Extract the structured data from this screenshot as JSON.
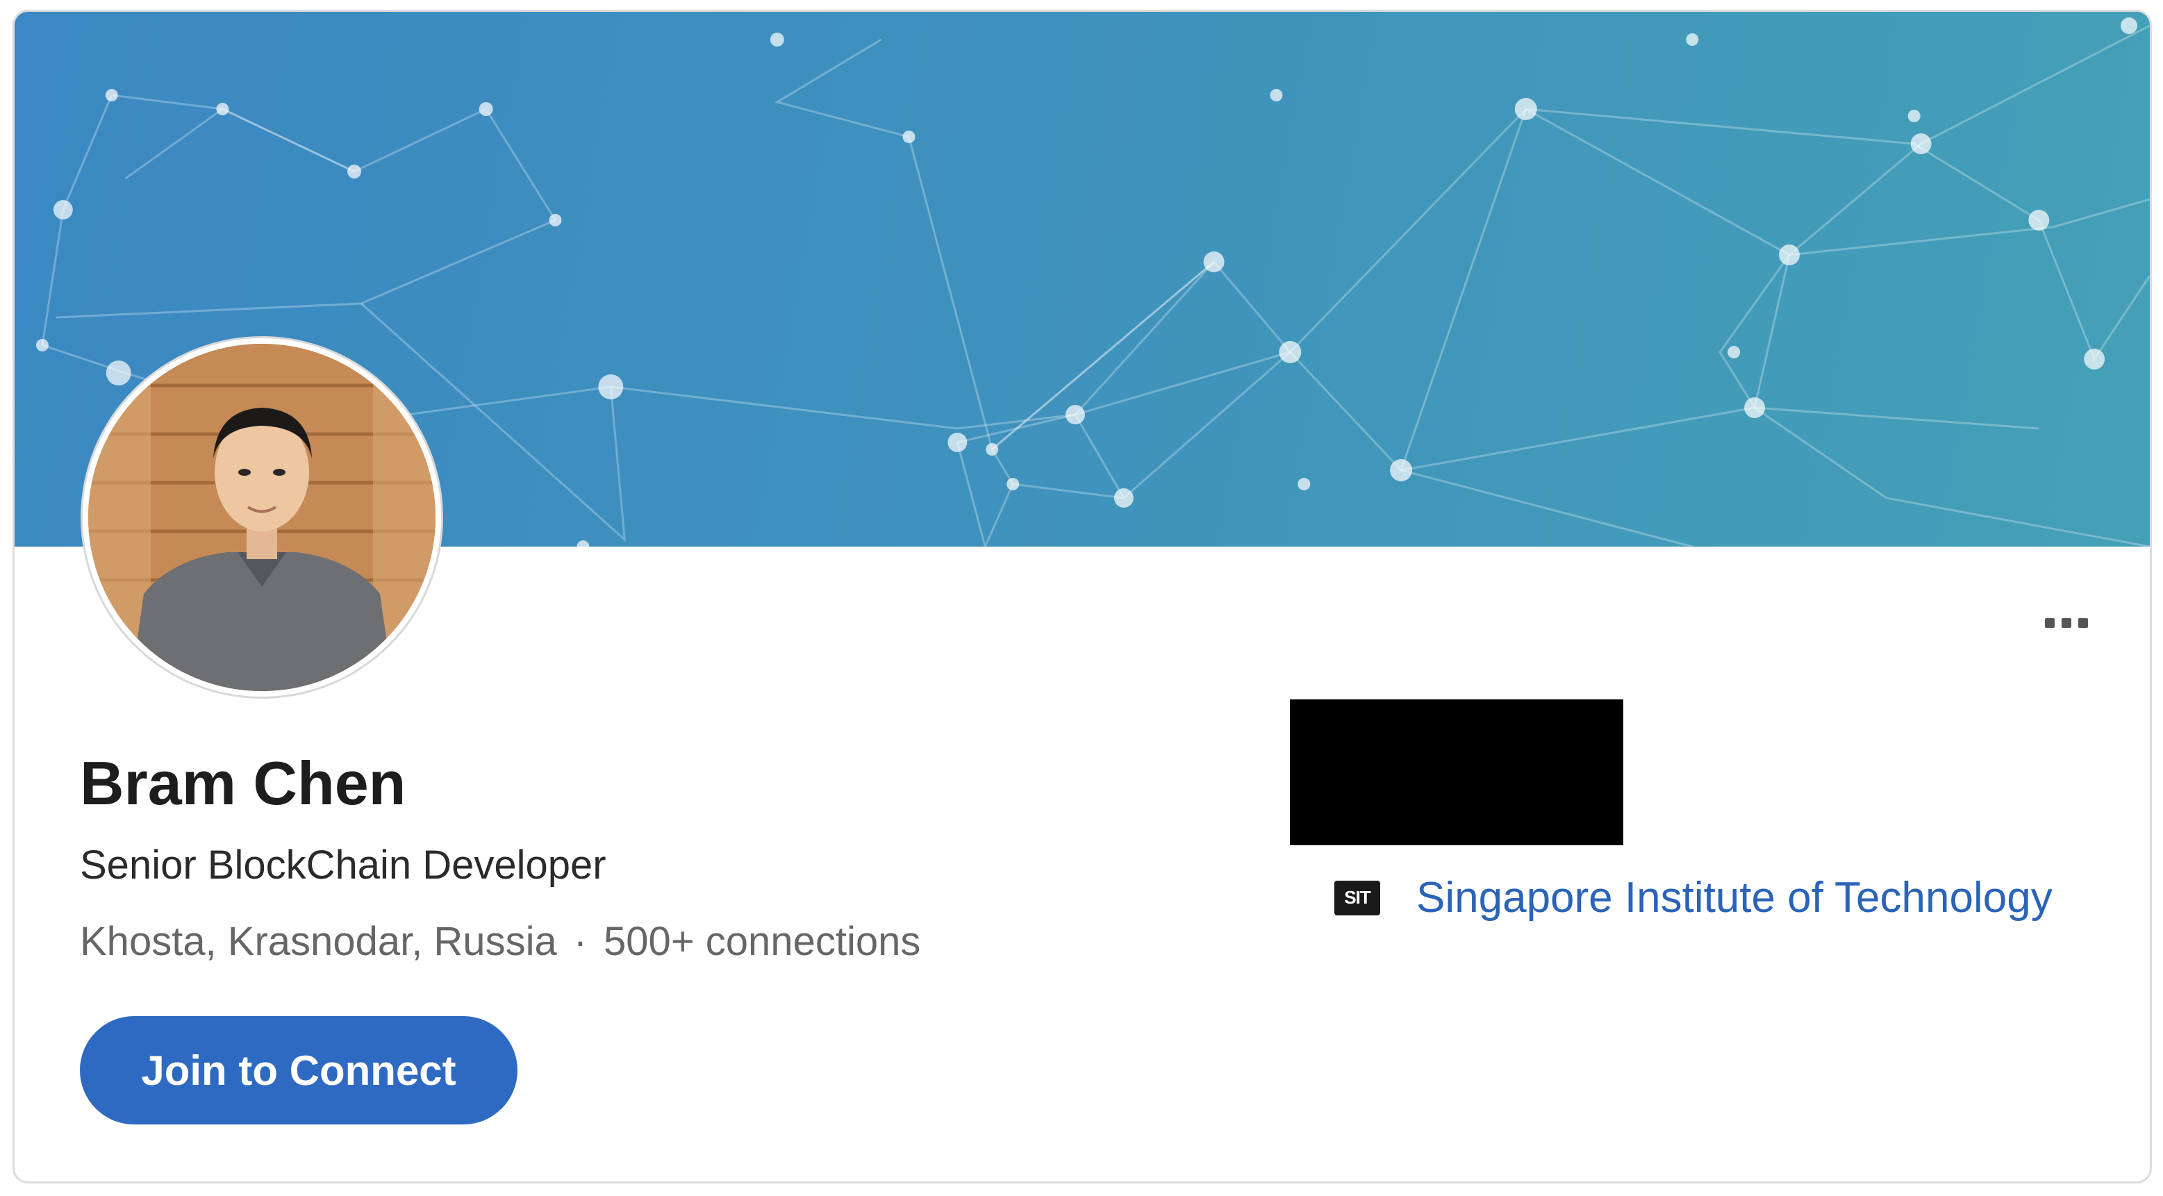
{
  "profile": {
    "name": "Bram Chen",
    "headline": "Senior BlockChain Developer",
    "location": "Khosta, Krasnodar, Russia",
    "separator": "·",
    "connections": "500+ connections",
    "join_button": "Join to Connect",
    "more_menu_icon": "ellipsis-icon"
  },
  "education": {
    "logo_text": "SIT",
    "school": "Singapore Institute of Technology"
  },
  "colors": {
    "banner_start": "#3b88c2",
    "banner_end": "#44a0b7",
    "button_bg": "#2e6ac2",
    "link": "#2a63b8"
  }
}
